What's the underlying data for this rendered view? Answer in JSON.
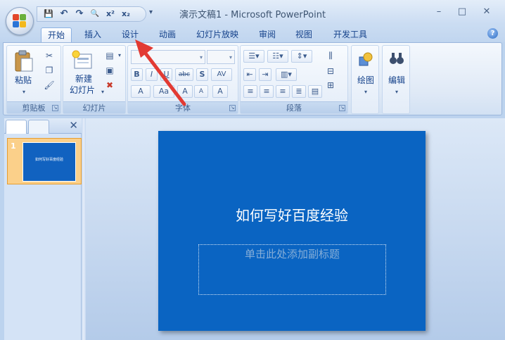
{
  "window": {
    "title": "演示文稿1 - Microsoft PowerPoint",
    "minimize": "–",
    "maximize": "□",
    "close": "✕"
  },
  "qat": {
    "save": "💾",
    "undo": "↶",
    "redo": "↷",
    "preview": "🔍",
    "superscript": "x²",
    "subscript": "x₂",
    "more": "▾"
  },
  "tabs": [
    {
      "label": "开始",
      "active": true
    },
    {
      "label": "插入"
    },
    {
      "label": "设计"
    },
    {
      "label": "动画"
    },
    {
      "label": "幻灯片放映"
    },
    {
      "label": "审阅"
    },
    {
      "label": "视图"
    },
    {
      "label": "开发工具"
    }
  ],
  "help": "?",
  "ribbon": {
    "clipboard": {
      "label": "剪贴板",
      "paste": "粘贴"
    },
    "slides": {
      "label": "幻灯片",
      "new_slide_line1": "新建",
      "new_slide_line2": "幻灯片"
    },
    "font": {
      "label": "字体",
      "bold": "B",
      "italic": "I",
      "underline": "U",
      "strike": "abc",
      "shadow": "S",
      "spacing": "AV",
      "grow": "A",
      "case": "Aa",
      "growfont": "A",
      "shrinkfont": "A",
      "clear": "A"
    },
    "paragraph": {
      "label": "段落"
    },
    "drawing": {
      "label": "绘图"
    },
    "editing": {
      "label": "编辑"
    }
  },
  "slides_pane": {
    "close": "✕",
    "thumb_num": "1",
    "thumb_text": "如何写好百度经验"
  },
  "slide": {
    "title": "如何写好百度经验",
    "subtitle_placeholder": "单击此处添加副标题"
  },
  "colors": {
    "slide_bg": "#0a64c2",
    "accent_arrow": "#e23a33"
  }
}
